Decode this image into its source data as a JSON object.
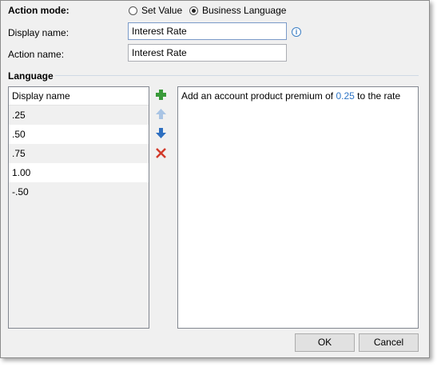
{
  "action_mode": {
    "label": "Action mode:",
    "options": [
      {
        "label": "Set Value",
        "selected": false
      },
      {
        "label": "Business Language",
        "selected": true
      }
    ]
  },
  "display_name": {
    "label": "Display name:",
    "value": "Interest Rate"
  },
  "action_name": {
    "label": "Action name:",
    "value": "Interest Rate"
  },
  "language": {
    "section_title": "Language",
    "list_header": "Display name",
    "items": [
      ".25",
      ".50",
      ".75",
      "1.00",
      "-.50"
    ],
    "toolbar": {
      "add_icon": "add-icon",
      "move_up_icon": "arrow-up-icon",
      "move_down_icon": "arrow-down-icon",
      "delete_icon": "delete-icon"
    },
    "editor": {
      "text_before": "Add an account product premium of ",
      "value": "0.25",
      "text_after": " to the rate"
    }
  },
  "buttons": {
    "ok": "OK",
    "cancel": "Cancel"
  },
  "colors": {
    "accent": "#2e75c6",
    "add_green": "#3a9a3a",
    "arrow_blue": "#2e6fc0",
    "delete_red": "#d23a2a"
  }
}
